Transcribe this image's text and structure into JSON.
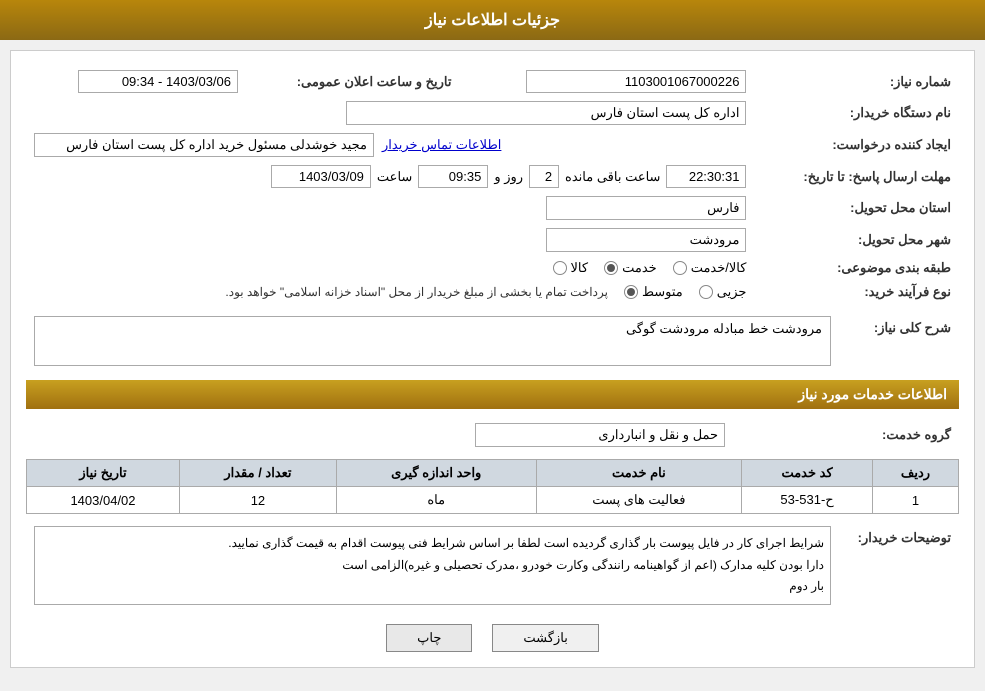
{
  "header": {
    "title": "جزئیات اطلاعات نیاز"
  },
  "sections": {
    "main_info": {
      "need_number_label": "شماره نیاز:",
      "need_number_value": "1103001067000226",
      "announce_date_label": "تاریخ و ساعت اعلان عمومی:",
      "announce_date_value": "1403/03/06 - 09:34",
      "org_name_label": "نام دستگاه خریدار:",
      "org_name_value": "اداره کل پست استان فارس",
      "creator_label": "ایجاد کننده درخواست:",
      "creator_value": "مجید خوشدلی مسئول خرید اداره کل پست استان فارس",
      "creator_link": "اطلاعات تماس خریدار",
      "response_deadline_label": "مهلت ارسال پاسخ: تا تاریخ:",
      "response_date": "1403/03/09",
      "response_time_label": "ساعت",
      "response_time_value": "09:35",
      "response_day_label": "روز و",
      "response_day_value": "2",
      "response_remaining_label": "ساعت باقی مانده",
      "response_remaining_value": "22:30:31",
      "province_label": "استان محل تحویل:",
      "province_value": "فارس",
      "city_label": "شهر محل تحویل:",
      "city_value": "مرودشت",
      "category_label": "طبقه بندی موضوعی:",
      "category_options": [
        {
          "label": "کالا",
          "selected": false
        },
        {
          "label": "خدمت",
          "selected": true
        },
        {
          "label": "کالا/خدمت",
          "selected": false
        }
      ],
      "purchase_type_label": "نوع فرآیند خرید:",
      "purchase_type_options": [
        {
          "label": "جزیی",
          "selected": false
        },
        {
          "label": "متوسط",
          "selected": true
        }
      ],
      "purchase_type_note": "پرداخت تمام یا بخشی از مبلغ خریدار از محل \"اسناد خزانه اسلامی\" خواهد بود.",
      "need_description_label": "شرح کلی نیاز:",
      "need_description_value": "مرودشت خط مبادله مرودشت گوگی"
    },
    "services": {
      "title": "اطلاعات خدمات مورد نیاز",
      "service_group_label": "گروه خدمت:",
      "service_group_value": "حمل و نقل و انبارداری",
      "table": {
        "columns": [
          "ردیف",
          "کد خدمت",
          "نام خدمت",
          "واحد اندازه گیری",
          "تعداد / مقدار",
          "تاریخ نیاز"
        ],
        "rows": [
          {
            "row": "1",
            "service_code": "ح-531-53",
            "service_name": "فعالیت های پست",
            "unit": "ماه",
            "quantity": "12",
            "date": "1403/04/02"
          }
        ]
      }
    },
    "buyer_notes": {
      "label": "توضیحات خریدار:",
      "text": "شرایط اجرای کار در فایل پیوست بار گذاری گردیده است لطفا بر اساس شرایط فنی پیوست اقدام به قیمت گذاری نمایید.\nدارا بودن کلیه مدارک (اعم از گواهینامه رانندگی وکارت خودرو ،مدرک تحصیلی و غیره)الزامی است\nبار دوم"
    }
  },
  "buttons": {
    "back_label": "بازگشت",
    "print_label": "چاپ"
  }
}
